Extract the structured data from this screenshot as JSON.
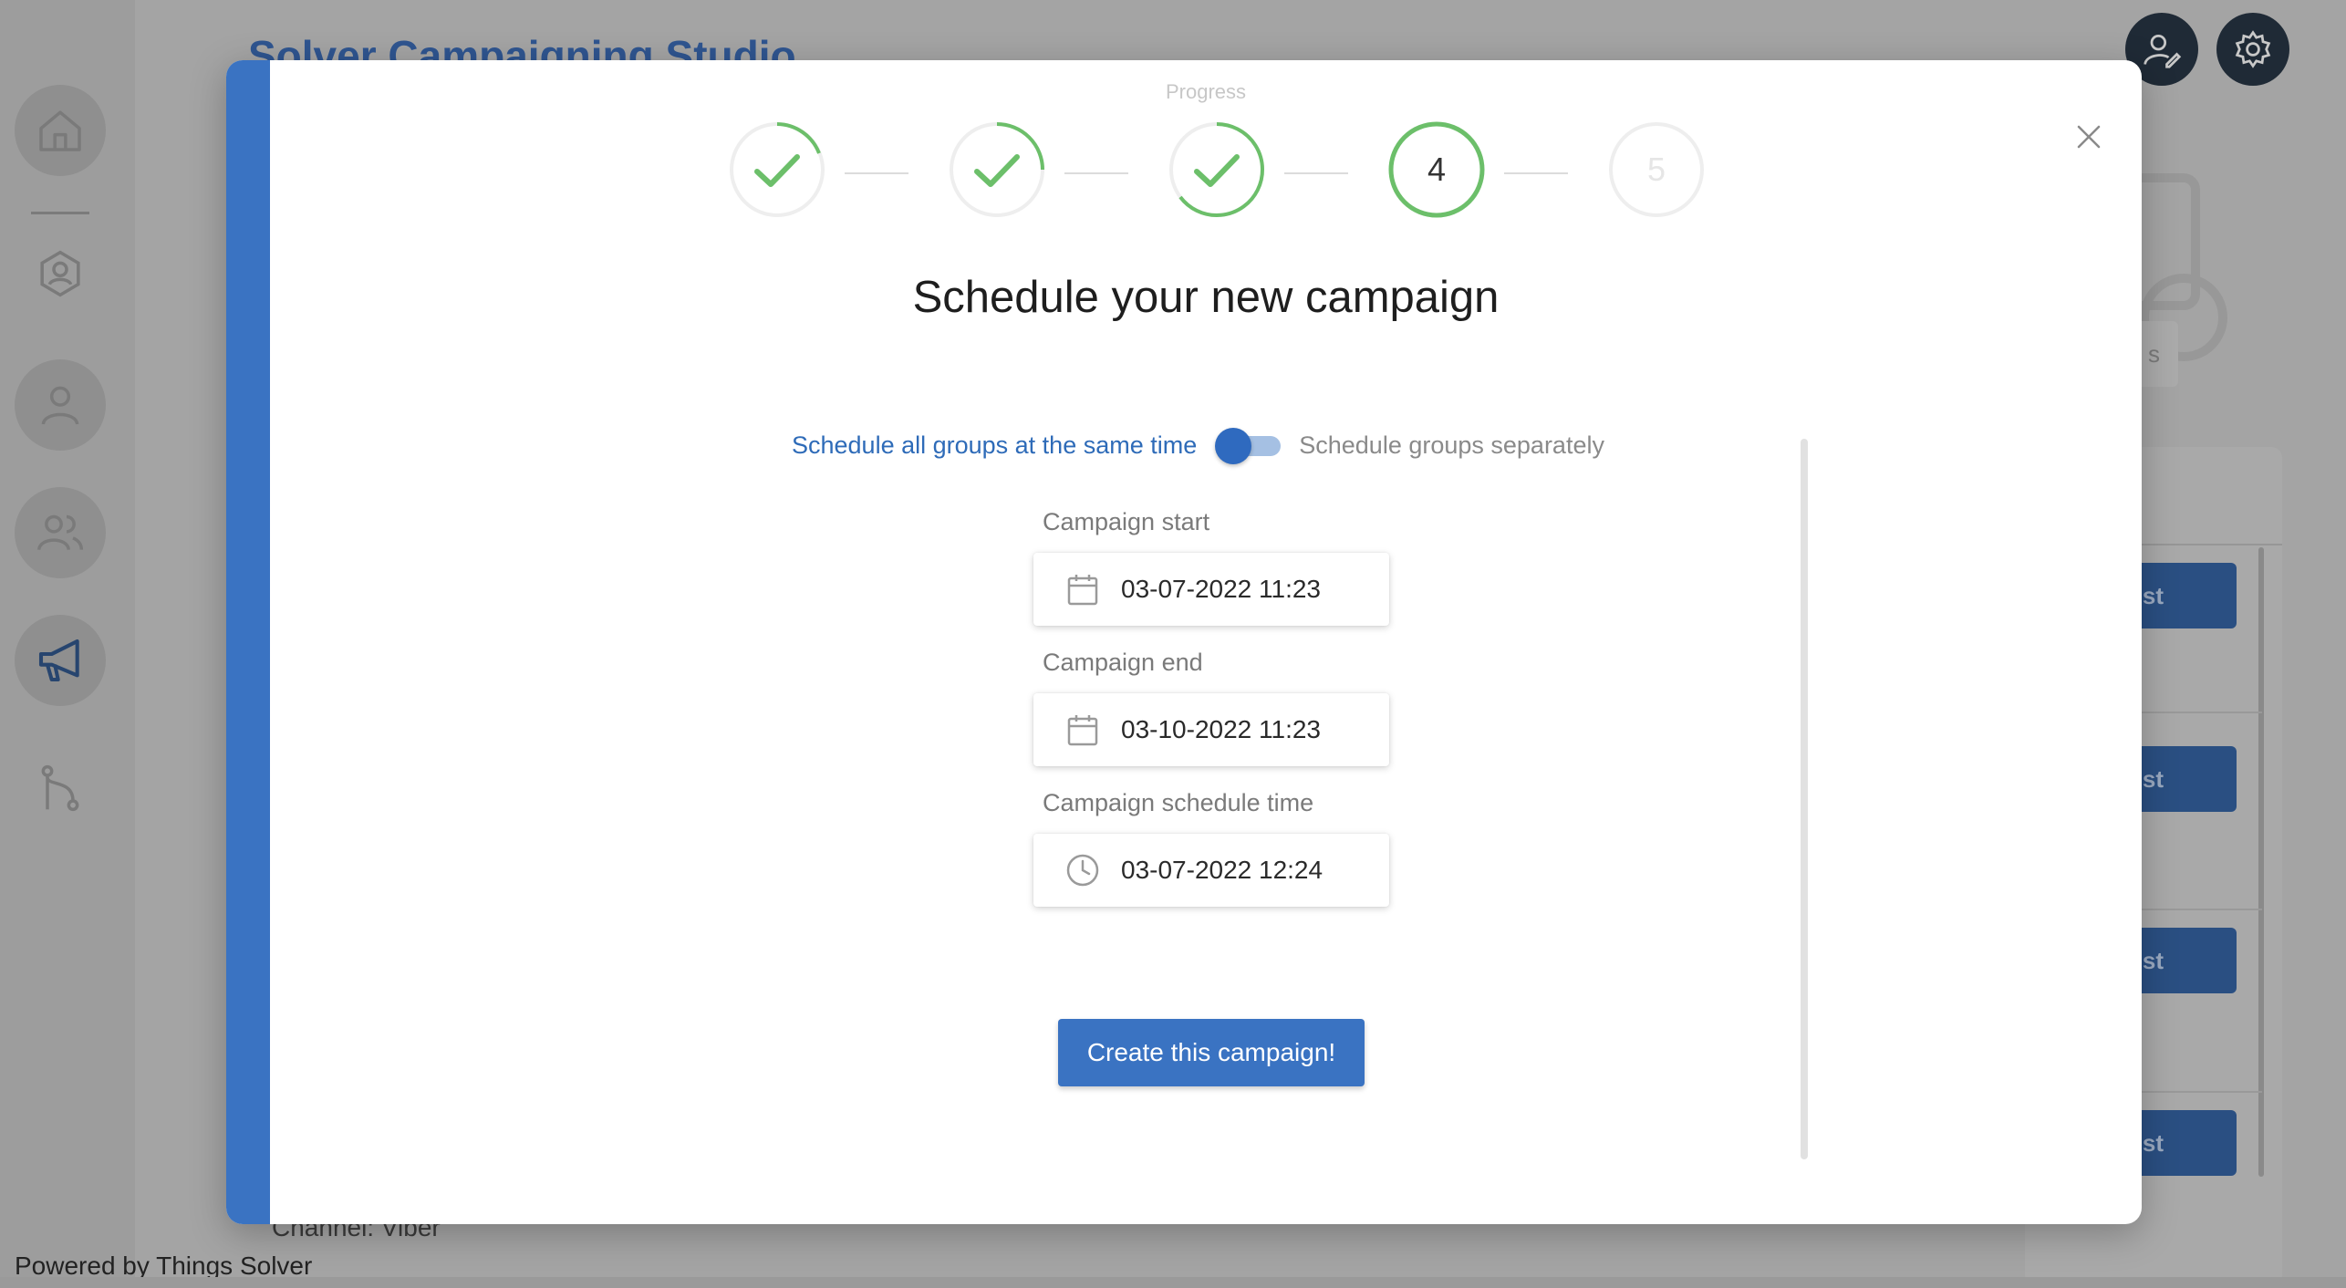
{
  "app": {
    "title": "Solver Campaigning Studio",
    "footer": "Powered by Things Solver",
    "background_fragments": {
      "channel_text": "Channel: Viber",
      "chip_text": "s",
      "row_button_text": "st"
    }
  },
  "sidebar": {
    "items": [
      {
        "icon": "home-icon"
      },
      {
        "icon": "user-settings-icon"
      },
      {
        "icon": "user-icon"
      },
      {
        "icon": "users-icon"
      },
      {
        "icon": "megaphone-icon",
        "active": true
      },
      {
        "icon": "git-branch-icon"
      }
    ]
  },
  "header": {
    "icons": [
      "user-edit-icon",
      "gear-icon"
    ]
  },
  "modal": {
    "progress_label": "Progress",
    "steps": [
      {
        "state": "done",
        "label": ""
      },
      {
        "state": "done",
        "label": ""
      },
      {
        "state": "done",
        "label": ""
      },
      {
        "state": "current",
        "label": "4"
      },
      {
        "state": "pending",
        "label": "5"
      }
    ],
    "title": "Schedule your new campaign",
    "toggle": {
      "left_label": "Schedule all groups at the same time",
      "right_label": "Schedule groups separately",
      "selected": "left"
    },
    "fields": [
      {
        "label": "Campaign start",
        "value": "03-07-2022 11:23",
        "icon": "calendar-icon"
      },
      {
        "label": "Campaign end",
        "value": "03-10-2022 11:23",
        "icon": "calendar-icon"
      },
      {
        "label": "Campaign schedule time",
        "value": "03-07-2022 12:24",
        "icon": "clock-icon"
      }
    ],
    "submit_label": "Create this campaign!"
  },
  "colors": {
    "accent": "#3a73c2",
    "success": "#6cbf6a",
    "toggle_active_text": "#2e6bb8"
  }
}
